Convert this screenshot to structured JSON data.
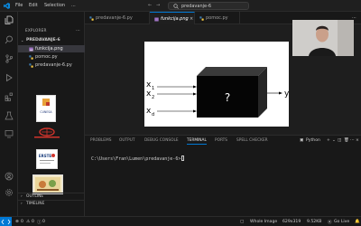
{
  "titlebar": {
    "menus": [
      "File",
      "Edit",
      "Selection",
      "..."
    ],
    "search_text": "predavanje-6"
  },
  "sidebar": {
    "title": "EXPLORER",
    "more": "...",
    "folder": "PREDAVANJE-6",
    "files": [
      {
        "name": "funkcija.png",
        "type": "image",
        "active": true
      },
      {
        "name": "pomoc.py",
        "type": "python",
        "active": false
      },
      {
        "name": "predavanje-6.py",
        "type": "python",
        "active": false
      }
    ],
    "logos": [
      {
        "label": "CUNESA"
      },
      {
        "label": "ERSTE"
      }
    ],
    "outline": "OUTLINE",
    "timeline": "TIMELINE"
  },
  "tabs": [
    {
      "label": "predavanje-6.py",
      "active": false
    },
    {
      "label": "funkcija.png",
      "active": true
    },
    {
      "label": "pomoc.py",
      "active": false
    }
  ],
  "diagram": {
    "inputs": [
      "x",
      "x",
      "x"
    ],
    "subscripts": [
      "1",
      "2",
      "d"
    ],
    "box_label": "?",
    "output": "y"
  },
  "panel": {
    "tabs": [
      "PROBLEMS",
      "OUTPUT",
      "DEBUG CONSOLE",
      "TERMINAL",
      "PORTS",
      "SPELL CHECKER"
    ],
    "active_tab": "TERMINAL",
    "terminal_kind": "Python",
    "prompt": "C:\\Users\\Fran\\Lumen\\predavanje-6>"
  },
  "statusbar": {
    "errors": "0",
    "warnings": "0",
    "info": "0",
    "file_kind": "Whole Image",
    "dimensions": "629x319",
    "size": "9.52KB",
    "zoom": "Go Live"
  }
}
